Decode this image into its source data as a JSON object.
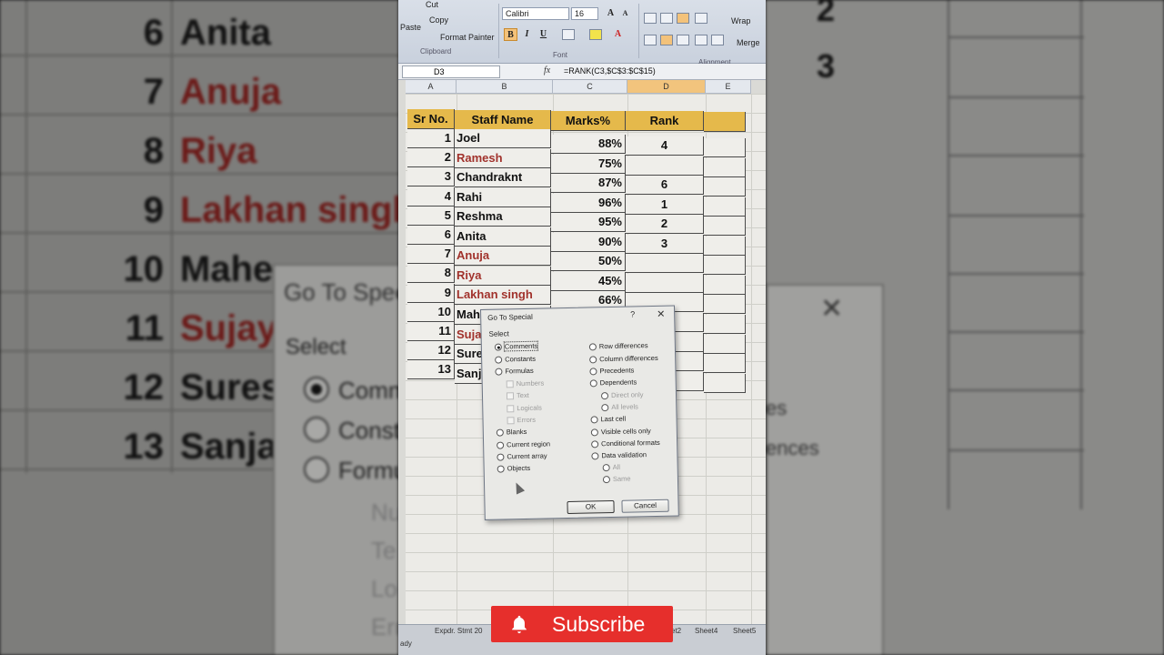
{
  "background_left": {
    "rows": [
      {
        "num": "6",
        "name": "Anita",
        "red": false
      },
      {
        "num": "7",
        "name": "Anuja",
        "red": true
      },
      {
        "num": "8",
        "name": "Riya",
        "red": true
      },
      {
        "num": "9",
        "name": "Lakhan singh",
        "red": true
      },
      {
        "num": "10",
        "name": "Mahe",
        "red": false
      },
      {
        "num": "11",
        "name": "Sujay",
        "red": true
      },
      {
        "num": "12",
        "name": "Sures",
        "red": false
      },
      {
        "num": "13",
        "name": "Sanja",
        "red": false
      }
    ],
    "dialog_title": "Go To Spec",
    "dialog_select": "Select",
    "dialog_options": [
      "Comm",
      "Const",
      "Formu",
      "Nu",
      "Te",
      "Lo",
      "Err"
    ]
  },
  "background_right": {
    "values": [
      "2",
      "3"
    ],
    "texts": [
      "es",
      "ences"
    ]
  },
  "ribbon": {
    "cut": "Cut",
    "copy": "Copy",
    "format_painter": "Format Painter",
    "paste": "Paste",
    "clipboard_group": "Clipboard",
    "font_name": "Calibri",
    "font_size": "16",
    "bold": "B",
    "italic": "I",
    "underline": "U",
    "font_color_glyph": "A",
    "font_group": "Font",
    "wrap": "Wrap",
    "merge": "Merge",
    "alignment_group": "Alignment"
  },
  "formula_bar": {
    "name_box": "D3",
    "fx": "fx",
    "formula": "=RANK(C3,$C$3:$C$15)"
  },
  "columns": [
    "A",
    "B",
    "C",
    "D",
    "E"
  ],
  "table": {
    "headers": [
      "Sr No.",
      "Staff Name",
      "Marks%",
      "Rank"
    ],
    "rows": [
      {
        "sr": "1",
        "name": "Joel",
        "red": false,
        "marks": "88%",
        "rank": "4"
      },
      {
        "sr": "2",
        "name": "Ramesh",
        "red": true,
        "marks": "75%",
        "rank": ""
      },
      {
        "sr": "3",
        "name": "Chandraknt",
        "red": false,
        "marks": "87%",
        "rank": "6"
      },
      {
        "sr": "4",
        "name": "Rahi",
        "red": false,
        "marks": "96%",
        "rank": "1"
      },
      {
        "sr": "5",
        "name": "Reshma",
        "red": false,
        "marks": "95%",
        "rank": "2"
      },
      {
        "sr": "6",
        "name": "Anita",
        "red": false,
        "marks": "90%",
        "rank": "3"
      },
      {
        "sr": "7",
        "name": "Anuja",
        "red": true,
        "marks": "50%",
        "rank": ""
      },
      {
        "sr": "8",
        "name": "Riya",
        "red": true,
        "marks": "45%",
        "rank": ""
      },
      {
        "sr": "9",
        "name": "Lakhan singh",
        "red": true,
        "marks": "66%",
        "rank": ""
      },
      {
        "sr": "10",
        "name": "Mahe",
        "red": false,
        "marks": "",
        "rank": ""
      },
      {
        "sr": "11",
        "name": "Sujay",
        "red": true,
        "marks": "",
        "rank": ""
      },
      {
        "sr": "12",
        "name": "Sures",
        "red": false,
        "marks": "",
        "rank": ""
      },
      {
        "sr": "13",
        "name": "Sanja",
        "red": false,
        "marks": "",
        "rank": ""
      }
    ]
  },
  "dialog": {
    "title": "Go To Special",
    "help": "?",
    "close": "✕",
    "select_label": "Select",
    "left_options": [
      {
        "label": "Comments",
        "type": "radio",
        "selected": true,
        "disabled": false
      },
      {
        "label": "Constants",
        "type": "radio",
        "selected": false,
        "disabled": false
      },
      {
        "label": "Formulas",
        "type": "radio",
        "selected": false,
        "disabled": false
      },
      {
        "label": "Numbers",
        "type": "check",
        "selected": false,
        "disabled": true
      },
      {
        "label": "Text",
        "type": "check",
        "selected": false,
        "disabled": true
      },
      {
        "label": "Logicals",
        "type": "check",
        "selected": false,
        "disabled": true
      },
      {
        "label": "Errors",
        "type": "check",
        "selected": false,
        "disabled": true
      },
      {
        "label": "Blanks",
        "type": "radio",
        "selected": false,
        "disabled": false
      },
      {
        "label": "Current region",
        "type": "radio",
        "selected": false,
        "disabled": false
      },
      {
        "label": "Current array",
        "type": "radio",
        "selected": false,
        "disabled": false
      },
      {
        "label": "Objects",
        "type": "radio",
        "selected": false,
        "disabled": false
      }
    ],
    "right_options": [
      {
        "label": "Row differences",
        "type": "radio",
        "selected": false,
        "disabled": false
      },
      {
        "label": "Column differences",
        "type": "radio",
        "selected": false,
        "disabled": false
      },
      {
        "label": "Precedents",
        "type": "radio",
        "selected": false,
        "disabled": false
      },
      {
        "label": "Dependents",
        "type": "radio",
        "selected": false,
        "disabled": false
      },
      {
        "label": "Direct only",
        "type": "radio",
        "selected": false,
        "disabled": true
      },
      {
        "label": "All levels",
        "type": "radio",
        "selected": false,
        "disabled": true
      },
      {
        "label": "Last cell",
        "type": "radio",
        "selected": false,
        "disabled": false
      },
      {
        "label": "Visible cells only",
        "type": "radio",
        "selected": false,
        "disabled": false
      },
      {
        "label": "Conditional formats",
        "type": "radio",
        "selected": false,
        "disabled": false
      },
      {
        "label": "Data validation",
        "type": "radio",
        "selected": false,
        "disabled": false
      },
      {
        "label": "All",
        "type": "radio",
        "selected": false,
        "disabled": true
      },
      {
        "label": "Same",
        "type": "radio",
        "selected": false,
        "disabled": true
      }
    ],
    "ok": "OK",
    "cancel": "Cancel"
  },
  "sheet_tabs": [
    "Expdr. Stmt 20",
    "et2",
    "Sheet4",
    "Sheet5"
  ],
  "status": "ady",
  "subscribe": {
    "label": "Subscribe",
    "icon": "bell-icon",
    "color": "#e62f2c"
  }
}
